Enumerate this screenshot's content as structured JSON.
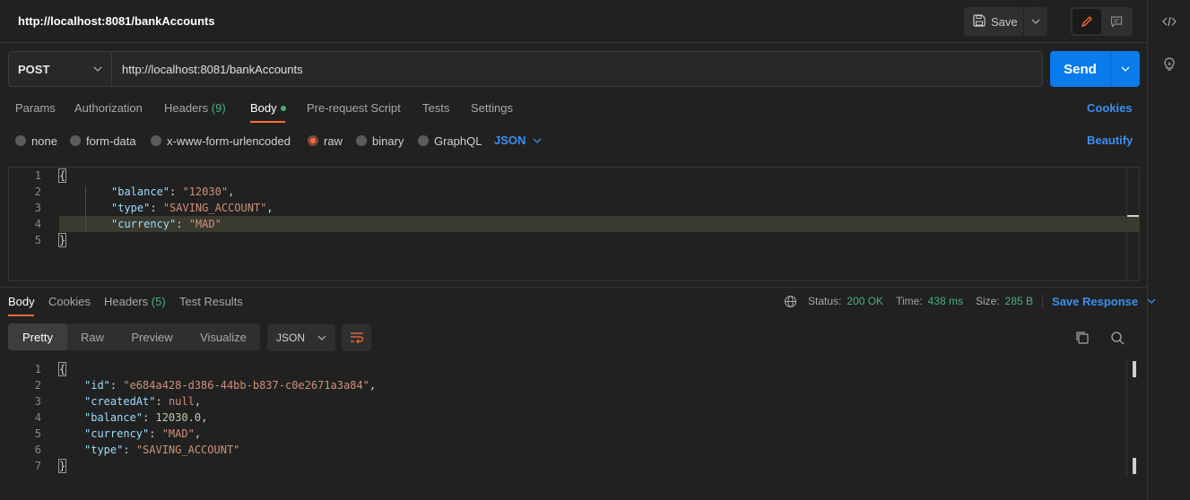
{
  "header": {
    "title": "http://localhost:8081/bankAccounts",
    "save_label": "Save"
  },
  "request": {
    "method": "POST",
    "url": "http://localhost:8081/bankAccounts",
    "send_label": "Send",
    "tabs": {
      "params": "Params",
      "authorization": "Authorization",
      "headers": "Headers",
      "headers_count": "(9)",
      "body": "Body",
      "prerequest": "Pre-request Script",
      "tests": "Tests",
      "settings": "Settings"
    },
    "cookies_label": "Cookies",
    "body_types": {
      "none": "none",
      "form_data": "form-data",
      "urlencoded": "x-www-form-urlencoded",
      "raw": "raw",
      "binary": "binary",
      "graphql": "GraphQL",
      "selected": "raw"
    },
    "format": "JSON",
    "beautify_label": "Beautify",
    "body_lines": {
      "n1": "1",
      "n2": "2",
      "n3": "3",
      "n4": "4",
      "n5": "5",
      "open": "{",
      "k1": "\"balance\"",
      "v1": "\"12030\"",
      "k2": "\"type\"",
      "v2": "\"SAVING_ACCOUNT\"",
      "k3": "\"currency\"",
      "v3": "\"MAD\"",
      "close": "}"
    }
  },
  "response": {
    "tabs": {
      "body": "Body",
      "cookies": "Cookies",
      "headers": "Headers",
      "headers_count": "(5)",
      "test_results": "Test Results"
    },
    "status_label": "Status:",
    "status_value": "200 OK",
    "time_label": "Time:",
    "time_value": "438 ms",
    "size_label": "Size:",
    "size_value": "285 B",
    "save_response_label": "Save Response",
    "views": {
      "pretty": "Pretty",
      "raw": "Raw",
      "preview": "Preview",
      "visualize": "Visualize"
    },
    "format": "JSON",
    "body_lines": {
      "n1": "1",
      "n2": "2",
      "n3": "3",
      "n4": "4",
      "n5": "5",
      "n6": "6",
      "n7": "7",
      "open": "{",
      "k1": "\"id\"",
      "v1": "\"e684a428-d386-44bb-b837-c0e2671a3a84\"",
      "k2": "\"createdAt\"",
      "v2": "null",
      "k3": "\"balance\"",
      "v3": "12030.0",
      "k4": "\"currency\"",
      "v4": "\"MAD\"",
      "k5": "\"type\"",
      "v5": "\"SAVING_ACCOUNT\"",
      "close": "}"
    }
  },
  "colors": {
    "accent": "#ff6c37",
    "primary": "#097bed",
    "success": "#49b07a",
    "link": "#3b8ff0"
  }
}
